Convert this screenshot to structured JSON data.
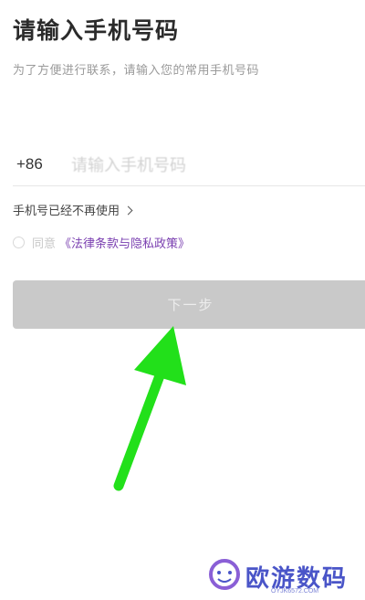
{
  "header": {
    "title": "请输入手机号码",
    "subtitle": "为了方便进行联系，请输入您的常用手机号码"
  },
  "phone": {
    "country_code": "+86",
    "placeholder": "请输入手机号码"
  },
  "links": {
    "number_unavailable": "手机号已经不再使用"
  },
  "agreement": {
    "prefix": "同意",
    "policy_link": "《法律条款与隐私政策》",
    "checked": false
  },
  "actions": {
    "next_label": "下一步"
  },
  "watermark": {
    "title": "欧游数码",
    "url": "OYJK6572.COM"
  },
  "colors": {
    "accent_link": "#7a3fb0",
    "button_disabled": "#c9c9c9",
    "arrow": "#22e01a",
    "watermark": "#4a55c8"
  }
}
